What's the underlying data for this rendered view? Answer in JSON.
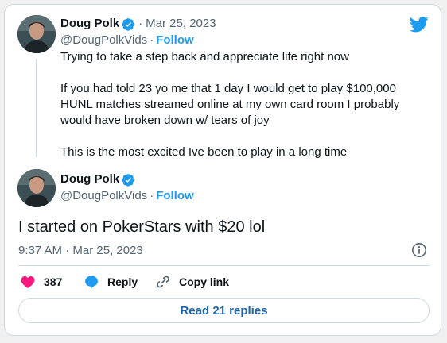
{
  "quoted_tweet": {
    "author_name": "Doug Polk",
    "date": "Mar 25, 2023",
    "handle": "@DougPolkVids",
    "follow_label": "Follow",
    "line1": "Trying to take a step back and appreciate life right now",
    "line2": "If you had told 23 yo me that 1 day I would get to play $100,000",
    "line3": "HUNL matches streamed online at my own card room I probably",
    "line4": "would have broken down w/ tears of joy",
    "line5": "This is the most excited Ive been to play in a long time"
  },
  "main_tweet": {
    "author_name": "Doug Polk",
    "handle": "@DougPolkVids",
    "follow_label": "Follow",
    "text": "I started on PokerStars with $20 lol",
    "timestamp": "9:37 AM · Mar 25, 2023"
  },
  "actions": {
    "likes": "387",
    "reply_label": "Reply",
    "copy_label": "Copy link"
  },
  "read_replies_label": "Read 21 replies",
  "colors": {
    "accent": "#1d9bf0",
    "like": "#f91880",
    "muted": "#536471"
  }
}
